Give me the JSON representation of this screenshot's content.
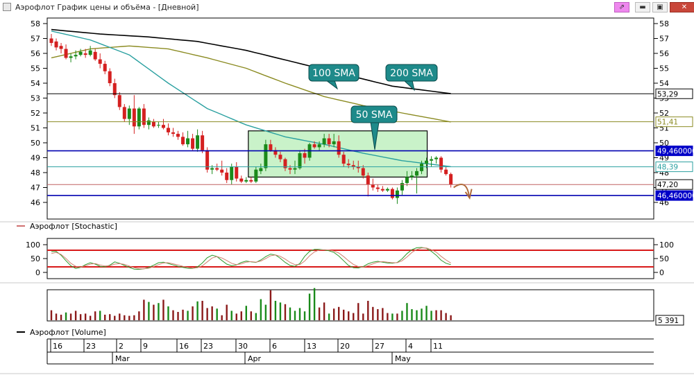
{
  "window": {
    "title": "Аэрофлот График цены и объёма - [Дневной]",
    "buttons": {
      "pin": "⇗",
      "minimize": "▬",
      "maximize": "▣",
      "close": "✕"
    }
  },
  "colors": {
    "up": "#1a8a1a",
    "down": "#d42020",
    "sma50": "#2aa0a0",
    "sma100": "#8a8a20",
    "sma200": "#000000",
    "callout": "#1e8a8a",
    "h_red": "#c06060",
    "h_blue": "#0000b0"
  },
  "chart_data": [
    {
      "type": "candlestick",
      "title": "",
      "ylim": [
        45.6,
        58.2
      ],
      "y_ticks": [
        "46",
        "47",
        "48",
        "49",
        "50",
        "51",
        "52",
        "53",
        "54",
        "55",
        "56",
        "57",
        "58"
      ],
      "x_ticks": [
        "16",
        "23",
        "2",
        "9",
        "16",
        "23",
        "30",
        "6",
        "13",
        "20",
        "27",
        "4",
        "11"
      ],
      "months": [
        "Mar",
        "Apr",
        "May"
      ],
      "candles": [
        {
          "o": 57.0,
          "h": 57.3,
          "l": 56.5,
          "c": 56.7
        },
        {
          "o": 56.8,
          "h": 57.0,
          "l": 56.2,
          "c": 56.4
        },
        {
          "o": 56.5,
          "h": 56.7,
          "l": 56.0,
          "c": 56.3
        },
        {
          "o": 56.3,
          "h": 56.6,
          "l": 55.6,
          "c": 55.7
        },
        {
          "o": 55.7,
          "h": 56.0,
          "l": 55.4,
          "c": 55.8
        },
        {
          "o": 55.8,
          "h": 56.2,
          "l": 55.6,
          "c": 55.9
        },
        {
          "o": 55.9,
          "h": 56.3,
          "l": 55.8,
          "c": 56.1
        },
        {
          "o": 56.0,
          "h": 56.3,
          "l": 55.7,
          "c": 55.9
        },
        {
          "o": 55.9,
          "h": 56.5,
          "l": 55.8,
          "c": 56.2
        },
        {
          "o": 56.1,
          "h": 56.3,
          "l": 55.5,
          "c": 55.6
        },
        {
          "o": 55.6,
          "h": 56.0,
          "l": 55.0,
          "c": 55.3
        },
        {
          "o": 55.3,
          "h": 55.5,
          "l": 54.6,
          "c": 54.8
        },
        {
          "o": 54.8,
          "h": 55.0,
          "l": 53.8,
          "c": 54.0
        },
        {
          "o": 54.0,
          "h": 54.3,
          "l": 53.0,
          "c": 53.2
        },
        {
          "o": 53.2,
          "h": 53.4,
          "l": 52.2,
          "c": 52.4
        },
        {
          "o": 52.4,
          "h": 52.6,
          "l": 51.4,
          "c": 51.6
        },
        {
          "o": 51.6,
          "h": 52.5,
          "l": 51.2,
          "c": 52.3
        },
        {
          "o": 52.3,
          "h": 53.2,
          "l": 50.6,
          "c": 51.1
        },
        {
          "o": 51.1,
          "h": 52.4,
          "l": 50.9,
          "c": 52.3
        },
        {
          "o": 52.3,
          "h": 52.6,
          "l": 51.0,
          "c": 51.2
        },
        {
          "o": 51.2,
          "h": 51.7,
          "l": 50.9,
          "c": 51.5
        },
        {
          "o": 51.4,
          "h": 51.6,
          "l": 51.0,
          "c": 51.1
        },
        {
          "o": 51.2,
          "h": 51.4,
          "l": 51.0,
          "c": 51.2
        },
        {
          "o": 51.2,
          "h": 51.6,
          "l": 50.9,
          "c": 51.0
        },
        {
          "o": 51.0,
          "h": 51.3,
          "l": 50.5,
          "c": 50.7
        },
        {
          "o": 50.7,
          "h": 51.0,
          "l": 50.4,
          "c": 50.6
        },
        {
          "o": 50.6,
          "h": 50.8,
          "l": 50.2,
          "c": 50.4
        },
        {
          "o": 50.4,
          "h": 50.7,
          "l": 49.8,
          "c": 49.9
        },
        {
          "o": 49.9,
          "h": 50.8,
          "l": 49.7,
          "c": 50.3
        },
        {
          "o": 50.3,
          "h": 50.6,
          "l": 49.5,
          "c": 49.6
        },
        {
          "o": 49.6,
          "h": 50.9,
          "l": 49.4,
          "c": 50.5
        },
        {
          "o": 50.5,
          "h": 50.8,
          "l": 49.3,
          "c": 49.5
        },
        {
          "o": 49.5,
          "h": 49.7,
          "l": 48.0,
          "c": 48.2
        },
        {
          "o": 48.2,
          "h": 48.5,
          "l": 47.9,
          "c": 48.3
        },
        {
          "o": 48.3,
          "h": 48.6,
          "l": 48.1,
          "c": 48.2
        },
        {
          "o": 48.2,
          "h": 48.8,
          "l": 47.8,
          "c": 48.0
        },
        {
          "o": 48.0,
          "h": 48.3,
          "l": 47.3,
          "c": 47.5
        },
        {
          "o": 47.5,
          "h": 48.6,
          "l": 47.2,
          "c": 48.4
        },
        {
          "o": 48.4,
          "h": 48.7,
          "l": 47.4,
          "c": 47.6
        },
        {
          "o": 47.6,
          "h": 47.8,
          "l": 47.3,
          "c": 47.4
        },
        {
          "o": 47.4,
          "h": 47.7,
          "l": 47.3,
          "c": 47.5
        },
        {
          "o": 47.5,
          "h": 47.7,
          "l": 47.3,
          "c": 47.4
        },
        {
          "o": 47.4,
          "h": 48.4,
          "l": 47.3,
          "c": 48.2
        },
        {
          "o": 48.1,
          "h": 48.6,
          "l": 47.9,
          "c": 48.3
        },
        {
          "o": 48.3,
          "h": 50.2,
          "l": 48.1,
          "c": 49.9
        },
        {
          "o": 49.9,
          "h": 50.2,
          "l": 49.4,
          "c": 49.5
        },
        {
          "o": 49.5,
          "h": 49.7,
          "l": 49.0,
          "c": 49.2
        },
        {
          "o": 49.2,
          "h": 49.4,
          "l": 48.7,
          "c": 48.9
        },
        {
          "o": 48.9,
          "h": 49.0,
          "l": 48.1,
          "c": 48.3
        },
        {
          "o": 48.3,
          "h": 48.5,
          "l": 47.9,
          "c": 48.2
        },
        {
          "o": 48.2,
          "h": 48.8,
          "l": 47.9,
          "c": 48.3
        },
        {
          "o": 48.3,
          "h": 49.5,
          "l": 48.2,
          "c": 49.3
        },
        {
          "o": 49.3,
          "h": 49.6,
          "l": 48.6,
          "c": 49.0
        },
        {
          "o": 49.0,
          "h": 50.0,
          "l": 48.8,
          "c": 49.9
        },
        {
          "o": 49.9,
          "h": 50.1,
          "l": 49.6,
          "c": 49.7
        },
        {
          "o": 49.7,
          "h": 50.1,
          "l": 49.5,
          "c": 49.9
        },
        {
          "o": 49.9,
          "h": 50.6,
          "l": 49.7,
          "c": 50.3
        },
        {
          "o": 50.3,
          "h": 50.6,
          "l": 49.7,
          "c": 49.9
        },
        {
          "o": 49.9,
          "h": 50.6,
          "l": 49.7,
          "c": 50.1
        },
        {
          "o": 50.1,
          "h": 50.5,
          "l": 49.0,
          "c": 49.2
        },
        {
          "o": 49.2,
          "h": 49.4,
          "l": 48.4,
          "c": 48.6
        },
        {
          "o": 48.6,
          "h": 48.9,
          "l": 48.3,
          "c": 48.5
        },
        {
          "o": 48.5,
          "h": 48.8,
          "l": 48.2,
          "c": 48.4
        },
        {
          "o": 48.4,
          "h": 48.8,
          "l": 48.0,
          "c": 48.3
        },
        {
          "o": 48.3,
          "h": 48.5,
          "l": 47.6,
          "c": 47.8
        },
        {
          "o": 47.8,
          "h": 48.0,
          "l": 46.4,
          "c": 47.2
        },
        {
          "o": 47.2,
          "h": 47.6,
          "l": 46.8,
          "c": 47.0
        },
        {
          "o": 47.0,
          "h": 47.2,
          "l": 46.7,
          "c": 46.9
        },
        {
          "o": 46.9,
          "h": 47.1,
          "l": 46.7,
          "c": 46.8
        },
        {
          "o": 46.8,
          "h": 47.0,
          "l": 46.7,
          "c": 46.9
        },
        {
          "o": 46.9,
          "h": 47.0,
          "l": 46.2,
          "c": 46.3
        },
        {
          "o": 46.3,
          "h": 47.0,
          "l": 45.9,
          "c": 46.8
        },
        {
          "o": 46.8,
          "h": 47.5,
          "l": 46.5,
          "c": 47.3
        },
        {
          "o": 47.3,
          "h": 48.1,
          "l": 47.1,
          "c": 47.7
        },
        {
          "o": 47.7,
          "h": 48.1,
          "l": 47.5,
          "c": 47.8
        },
        {
          "o": 47.8,
          "h": 48.3,
          "l": 46.6,
          "c": 48.1
        },
        {
          "o": 48.1,
          "h": 48.8,
          "l": 47.9,
          "c": 48.6
        },
        {
          "o": 48.6,
          "h": 49.0,
          "l": 48.3,
          "c": 48.8
        },
        {
          "o": 48.8,
          "h": 49.1,
          "l": 48.4,
          "c": 48.9
        },
        {
          "o": 48.9,
          "h": 49.1,
          "l": 48.6,
          "c": 49.0
        },
        {
          "o": 49.0,
          "h": 49.1,
          "l": 48.0,
          "c": 48.2
        },
        {
          "o": 48.2,
          "h": 48.4,
          "l": 47.8,
          "c": 47.9
        },
        {
          "o": 47.9,
          "h": 48.0,
          "l": 47.0,
          "c": 47.2
        }
      ],
      "sma50": [
        [
          0,
          57.5
        ],
        [
          8,
          56.9
        ],
        [
          16,
          55.9
        ],
        [
          24,
          54.0
        ],
        [
          32,
          52.3
        ],
        [
          40,
          51.2
        ],
        [
          48,
          50.4
        ],
        [
          56,
          49.9
        ],
        [
          64,
          49.3
        ],
        [
          72,
          48.8
        ],
        [
          82,
          48.4
        ]
      ],
      "sma100": [
        [
          0,
          55.7
        ],
        [
          8,
          56.3
        ],
        [
          16,
          56.5
        ],
        [
          24,
          56.3
        ],
        [
          32,
          55.7
        ],
        [
          40,
          55.0
        ],
        [
          48,
          54.0
        ],
        [
          56,
          53.1
        ],
        [
          64,
          52.5
        ],
        [
          72,
          52.0
        ],
        [
          82,
          51.4
        ]
      ],
      "sma200": [
        [
          0,
          57.6
        ],
        [
          10,
          57.3
        ],
        [
          20,
          57.1
        ],
        [
          30,
          56.8
        ],
        [
          40,
          56.2
        ],
        [
          50,
          55.4
        ],
        [
          60,
          54.6
        ],
        [
          70,
          53.8
        ],
        [
          82,
          53.3
        ]
      ],
      "sma_labels": [
        "100 SMA",
        "200 SMA",
        "50 SMA"
      ],
      "price_labels": [
        "53,29",
        "51,41",
        "49,460000",
        "48,39",
        "47,20",
        "46,460000"
      ],
      "price_levels": [
        53.29,
        51.41,
        49.46,
        48.39,
        47.2,
        46.46
      ],
      "highlight_box": {
        "x_from": 41,
        "x_to": 77,
        "y_from": 47.7,
        "y_to": 50.8
      }
    },
    {
      "type": "line",
      "title": "Аэрофлот [Stochastic]",
      "ylim": [
        -10,
        115
      ],
      "y_ticks": [
        "0",
        "50",
        "100"
      ],
      "levels": [
        80,
        20
      ],
      "series": [
        {
          "values": [
            75,
            76,
            62,
            42,
            24,
            14,
            18,
            28,
            35,
            30,
            22,
            20,
            26,
            38,
            33,
            25,
            18,
            12,
            11,
            13,
            18,
            26,
            35,
            37,
            32,
            27,
            22,
            18,
            15,
            14,
            20,
            34,
            53,
            62,
            57,
            43,
            30,
            24,
            27,
            36,
            41,
            38,
            36,
            45,
            57,
            66,
            63,
            51,
            36,
            25,
            22,
            32,
            58,
            76,
            83,
            83,
            81,
            78,
            72,
            59,
            42,
            25,
            17,
            16,
            21,
            31,
            37,
            40,
            37,
            34,
            33,
            36,
            49,
            68,
            82,
            89,
            90,
            87,
            76,
            62,
            44,
            33,
            28
          ]
        },
        {
          "values": [
            68,
            72,
            65,
            50,
            33,
            22,
            19,
            24,
            30,
            32,
            27,
            23,
            24,
            30,
            32,
            29,
            23,
            17,
            13,
            13,
            15,
            21,
            28,
            34,
            35,
            31,
            27,
            22,
            18,
            15,
            17,
            24,
            38,
            52,
            57,
            52,
            43,
            33,
            28,
            31,
            37,
            39,
            37,
            41,
            50,
            60,
            63,
            58,
            48,
            36,
            28,
            28,
            41,
            60,
            74,
            81,
            82,
            81,
            77,
            70,
            57,
            42,
            29,
            21,
            19,
            24,
            31,
            37,
            39,
            37,
            35,
            35,
            42,
            56,
            72,
            83,
            88,
            88,
            82,
            73,
            58,
            45,
            34
          ]
        }
      ]
    },
    {
      "type": "bar",
      "title": "Аэрофлот [Volume]",
      "value_label": "5 391",
      "colors": [
        "d",
        "d",
        "d",
        "u",
        "d",
        "d",
        "d",
        "d",
        "d",
        "d",
        "u",
        "d",
        "d",
        "d",
        "d",
        "d",
        "d",
        "d",
        "d",
        "d",
        "u",
        "d",
        "u",
        "d",
        "u",
        "d",
        "d",
        "d",
        "u",
        "d",
        "u",
        "d",
        "d",
        "d",
        "u",
        "d",
        "d",
        "u",
        "d",
        "d",
        "u",
        "d",
        "u",
        "u",
        "u",
        "d",
        "u",
        "u",
        "d",
        "u",
        "u",
        "u",
        "u",
        "u",
        "u",
        "d",
        "d",
        "u",
        "d",
        "d",
        "d",
        "d",
        "d",
        "d",
        "d",
        "d",
        "d",
        "d",
        "d",
        "d",
        "u",
        "d",
        "u",
        "u",
        "u",
        "u",
        "u",
        "u",
        "u",
        "d",
        "d",
        "d",
        "d"
      ],
      "heights": [
        18,
        12,
        10,
        14,
        12,
        17,
        11,
        12,
        8,
        16,
        17,
        10,
        11,
        8,
        12,
        9,
        8,
        9,
        16,
        37,
        33,
        28,
        31,
        37,
        25,
        18,
        15,
        19,
        17,
        25,
        34,
        35,
        22,
        25,
        21,
        9,
        28,
        17,
        12,
        16,
        26,
        16,
        13,
        38,
        28,
        54,
        35,
        32,
        29,
        23,
        17,
        22,
        16,
        48,
        58,
        23,
        32,
        12,
        21,
        24,
        19,
        16,
        13,
        31,
        12,
        35,
        24,
        20,
        22,
        13,
        12,
        12,
        17,
        31,
        20,
        18,
        21,
        26,
        17,
        18,
        18,
        13,
        9
      ]
    }
  ],
  "stoch_legend": "Аэрофлот [Stochastic]",
  "volume_legend": "Аэрофлот [Volume]"
}
